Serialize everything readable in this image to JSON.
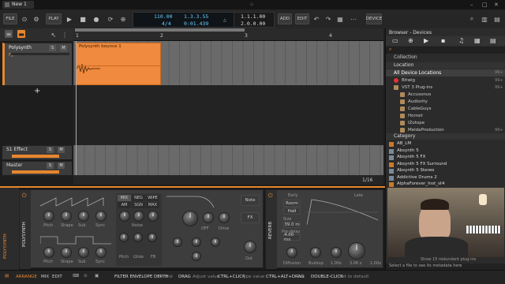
{
  "window": {
    "tab": "New 1",
    "title_mark": "bitwig"
  },
  "toolbar": {
    "file": "FILE",
    "play": "PLAY",
    "tempo": "110.00",
    "sig": "4/4",
    "pos_bars": "1.3.3.55",
    "pos_time": "0:01.439",
    "loop_start": "1.1.1.00",
    "loop_len": "2.0.0.00",
    "add": "ADD",
    "edit": "EDIT",
    "device": "DEVICE"
  },
  "ruler": {
    "marks": [
      "1",
      "2",
      "3",
      "4"
    ]
  },
  "tracks": [
    {
      "name": "Polysynth",
      "label": "Fg",
      "s": "S",
      "m": "M"
    },
    {
      "name": "S1 Effect",
      "s": "S",
      "m": "M"
    },
    {
      "name": "Master",
      "s": "S",
      "m": "M"
    }
  ],
  "clip": {
    "name": "Polysynth bounce 1"
  },
  "zoom": "1/16",
  "browser": {
    "header": "Browser - Devices",
    "collection": "Collection",
    "location": "Location",
    "all_locations": "All Device Locations",
    "all_count": "99+",
    "items": [
      "Bitwig",
      "VST 3 Plug-ins",
      "Accusonus",
      "Audiority",
      "CableGuys",
      "Hornet",
      "IZotope",
      "MeldaProduction"
    ],
    "counts": [
      "99+",
      "99+",
      "",
      "",
      "",
      "",
      "",
      "99+"
    ],
    "category": "Category",
    "devices": [
      "AB_LM",
      "Absynth 5",
      "Absynth 5 FX",
      "Absynth 5 FX Surround",
      "Absynth 5 Stereo",
      "Addictive Drums 2",
      "AlphaForever_Inst_st4"
    ],
    "redundant": "Show 15 redundant plug-ins",
    "footer": "Select a file to see its metadata here"
  },
  "device": {
    "name": "POLYSYNTH",
    "osc_labels": [
      "Pitch",
      "Shape",
      "Sub",
      "Sync"
    ],
    "mix_tabs": [
      "MIX",
      "NEG",
      "WIPE"
    ],
    "mix_row2": [
      "AM",
      "SGN",
      "MAX"
    ],
    "noise": "Noise",
    "drive": "Drive",
    "fm": "FM",
    "note": "Note",
    "fx": "FX",
    "out": "Out",
    "glide": "Glide",
    "pitch": "Pitch",
    "off": "OFF",
    "fb": "FB"
  },
  "reverb": {
    "name": "REVERB",
    "early": "Early",
    "room": "Room",
    "hall": "Hall",
    "size": "Size",
    "size_val": "39.0 m",
    "predelay": "Pre-delay",
    "predelay_val": "4.00 ms",
    "late": "Late",
    "diffusion": "Diffusion",
    "buildup": "Buildup",
    "v1": "1.00s",
    "v2": "3.06 s",
    "v3": "1.00x"
  },
  "statusbar": {
    "arrange": "ARRANGE",
    "mix": "MIX",
    "edit": "EDIT",
    "hint1": "FILTER ENVELOPE DEPTH",
    "hint1v": "0.00 st",
    "drag": "DRAG",
    "drag_t": "Adjust value",
    "ctrl": "CTRL+CLICK",
    "ctrl_t": "Type value",
    "ctrlalt": "CTRL+ALT+DRAG",
    "ctrlalt_t": "Pan",
    "dbl": "DOUBLE-CLICK",
    "dbl_t": "Set to default"
  },
  "colors": {
    "accent": "#e8862e",
    "clip": "#f08a3e",
    "panel": "#3d3d3d"
  }
}
